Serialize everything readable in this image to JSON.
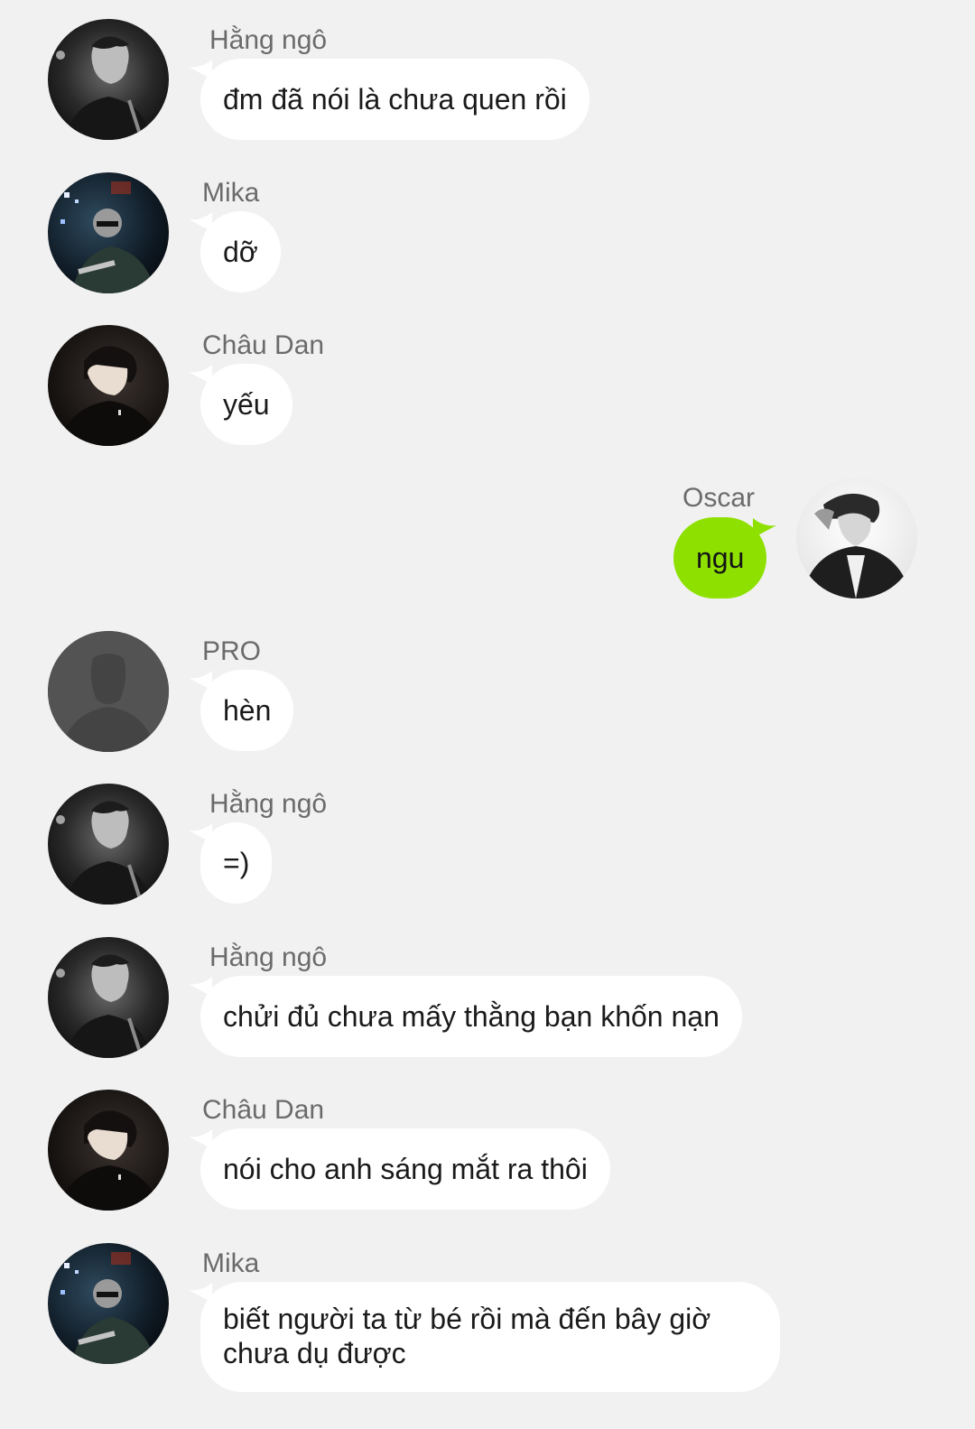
{
  "colors": {
    "background": "#f1f1f1",
    "incoming_bubble": "#ffffff",
    "outgoing_bubble": "#8ee000",
    "sender_name": "#6b6b6b",
    "text": "#1a1a1a"
  },
  "messages": [
    {
      "sender": "Hằng ngô",
      "text": "đm đã nói là chưa quen rồi",
      "avatar": "avatar-hang-ngo-photo",
      "outgoing": false
    },
    {
      "sender": "Mika",
      "text": "dỡ",
      "avatar": "avatar-mika-photo",
      "outgoing": false
    },
    {
      "sender": "Châu Dan",
      "text": "yếu",
      "avatar": "avatar-chau-dan-photo",
      "outgoing": false
    },
    {
      "sender": "Oscar",
      "text": "ngu",
      "avatar": "avatar-oscar-photo",
      "outgoing": true
    },
    {
      "sender": "PRO",
      "text": "hèn",
      "avatar": "default-person-silhouette-icon",
      "outgoing": false
    },
    {
      "sender": "Hằng ngô",
      "text": "=)",
      "avatar": "avatar-hang-ngo-photo",
      "outgoing": false
    },
    {
      "sender": "Hằng ngô",
      "text": "chửi đủ chưa mấy thằng bạn khốn nạn",
      "avatar": "avatar-hang-ngo-photo",
      "outgoing": false
    },
    {
      "sender": "Châu Dan",
      "text": "nói cho anh sáng mắt ra thôi",
      "avatar": "avatar-chau-dan-photo",
      "outgoing": false
    },
    {
      "sender": "Mika",
      "text": "biết người ta từ bé rồi mà đến bây giờ chưa dụ được",
      "avatar": "avatar-mika-photo",
      "outgoing": false
    }
  ]
}
